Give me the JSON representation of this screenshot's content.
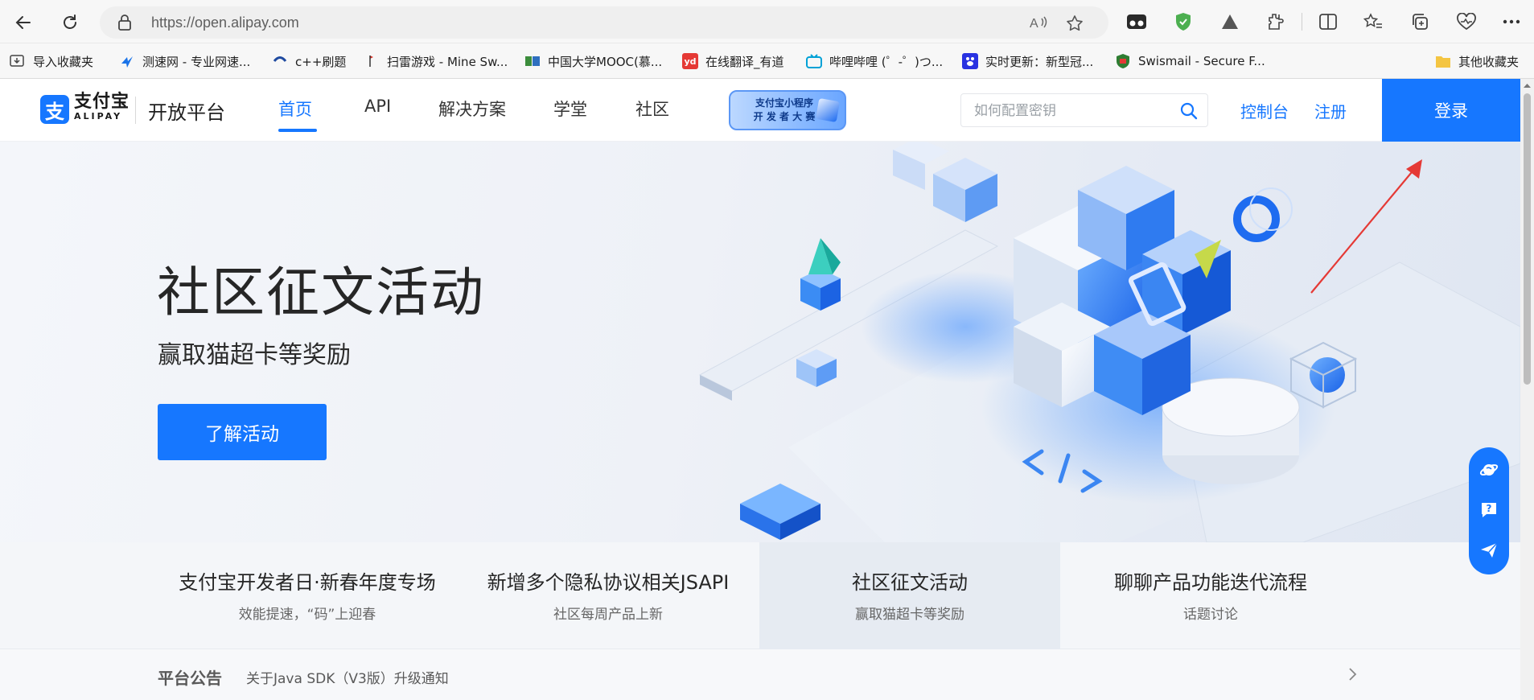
{
  "browser": {
    "url": "https://open.alipay.com",
    "bookmarks": [
      {
        "label": "导入收藏夹",
        "icon": "import-icon"
      },
      {
        "label": "测速网 - 专业网速...",
        "icon": "speedtest-icon"
      },
      {
        "label": "c++刷题",
        "icon": "code-icon"
      },
      {
        "label": "扫雷游戏 - Mine Sw...",
        "icon": "minesweeper-icon"
      },
      {
        "label": "中国大学MOOC(慕...",
        "icon": "mooc-icon"
      },
      {
        "label": "在线翻译_有道",
        "icon": "youdao-icon"
      },
      {
        "label": "哔哩哔哩 (゜-゜)つ...",
        "icon": "bilibili-icon"
      },
      {
        "label": "实时更新：新型冠...",
        "icon": "baidu-icon"
      },
      {
        "label": "Swismail - Secure F...",
        "icon": "shield-mail-icon"
      }
    ],
    "other_bookmarks": "其他收藏夹"
  },
  "header": {
    "logo_cn": "支付宝",
    "logo_en": "ALIPAY",
    "logo_mark": "支",
    "platform": "开放平台",
    "nav": [
      {
        "label": "首页",
        "active": true
      },
      {
        "label": "API",
        "active": false
      },
      {
        "label": "解决方案",
        "active": false
      },
      {
        "label": "学堂",
        "active": false
      },
      {
        "label": "社区",
        "active": false
      }
    ],
    "badge_line1": "支付宝小程序",
    "badge_line2": "开 发 者 大 赛",
    "search_placeholder": "如何配置密钥",
    "console": "控制台",
    "register": "注册",
    "login": "登录",
    "accent_color": "#1677ff"
  },
  "hero": {
    "title": "社区征文活动",
    "subtitle": "赢取猫超卡等奖励",
    "cta": "了解活动"
  },
  "features": [
    {
      "title": "支付宝开发者日·新春年度专场",
      "subtitle": "效能提速，“码”上迎春",
      "highlight": false
    },
    {
      "title": "新增多个隐私协议相关JSAPI",
      "subtitle": "社区每周产品上新",
      "highlight": false
    },
    {
      "title": "社区征文活动",
      "subtitle": "赢取猫超卡等奖励",
      "highlight": true
    },
    {
      "title": "聊聊产品功能迭代流程",
      "subtitle": "话题讨论",
      "highlight": false
    }
  ],
  "notice": {
    "label": "平台公告",
    "text": "关于Java SDK（V3版）升级通知"
  },
  "float_tools": [
    "planet-icon",
    "help-icon",
    "feedback-plane-icon"
  ]
}
